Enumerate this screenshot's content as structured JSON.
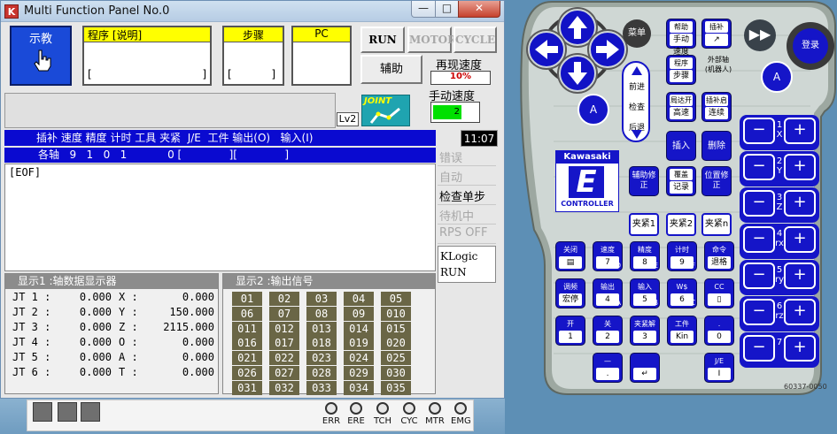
{
  "window": {
    "title": "Multi Function Panel No.0",
    "icon_letter": "K",
    "min": "—",
    "max": "□",
    "close": "✕"
  },
  "mode": {
    "label": "示教",
    "icon": "hand-pointer-icon"
  },
  "fields": {
    "program": {
      "label": "程序 [说明]",
      "value_open": "[",
      "value_close": "]"
    },
    "step": {
      "label": "步骤",
      "value_open": "[",
      "value_close": "]"
    },
    "pc": {
      "label": "PC"
    }
  },
  "buttons": {
    "run": "RUN",
    "motor": "MOTOR",
    "cycle": "CYCLE",
    "aux": "辅助"
  },
  "speed": {
    "replay_label": "再现速度",
    "replay_value": "10%",
    "manual_label": "手动速度",
    "manual_value": "2"
  },
  "level": "Lv2",
  "joint_label": "JOINT",
  "status_bar": {
    "header": "插补 速度 精度 计时 工具 夹紧  J/E  工件 输出(O)   输入(I)",
    "values": "各轴   9   1   0   1            0 [              ][              ]",
    "clock": "11:07"
  },
  "program_text": "[EOF]",
  "side_status": [
    "错误",
    "自动",
    "检查单步",
    "待机中",
    "RPS OFF"
  ],
  "side_status_enabled": [
    false,
    false,
    true,
    false,
    false
  ],
  "klogic": [
    "KLogic",
    "RUN"
  ],
  "display1": {
    "title": "显示1 :轴数据显示器",
    "rows": [
      {
        "jt": "JT 1 :",
        "jv": "0.000",
        "ax": "X :",
        "av": "0.000"
      },
      {
        "jt": "JT 2 :",
        "jv": "0.000",
        "ax": "Y :",
        "av": "150.000"
      },
      {
        "jt": "JT 3 :",
        "jv": "0.000",
        "ax": "Z :",
        "av": "2115.000"
      },
      {
        "jt": "JT 4 :",
        "jv": "0.000",
        "ax": "O :",
        "av": "0.000"
      },
      {
        "jt": "JT 5 :",
        "jv": "0.000",
        "ax": "A :",
        "av": "0.000"
      },
      {
        "jt": "JT 6 :",
        "jv": "0.000",
        "ax": "T :",
        "av": "0.000"
      }
    ]
  },
  "display2": {
    "title": "显示2 :输出信号",
    "signals": [
      "01",
      "02",
      "03",
      "04",
      "05",
      "06",
      "07",
      "08",
      "09",
      "010",
      "011",
      "012",
      "013",
      "014",
      "015",
      "016",
      "017",
      "018",
      "019",
      "020",
      "021",
      "022",
      "023",
      "024",
      "025",
      "026",
      "027",
      "028",
      "029",
      "030",
      "031",
      "032",
      "033",
      "034",
      "035"
    ]
  },
  "taskbar": {
    "lamps": [
      "ERR",
      "ERE",
      "TCH",
      "CYC",
      "MTR",
      "EMG"
    ]
  },
  "pendant": {
    "menu": "菜单",
    "login": "登录",
    "a": "A",
    "forward": "前进",
    "check": "检查",
    "back": "后退",
    "top_keys": [
      {
        "cap": "帮助",
        "sub": "手动速度"
      },
      {
        "cap": "插补",
        "sub": "↗"
      },
      {
        "cap": "程序",
        "sub": "步骤"
      },
      {
        "cap": "外部轴",
        "sub": "(机器人)"
      },
      {
        "cap": "局达开",
        "sub": "高速"
      },
      {
        "cap": "插补启动",
        "sub": "连续"
      }
    ],
    "insert": "插入",
    "delete": "删除",
    "aux_mod": "辅助修正",
    "cover": "覆盖",
    "record": "记录",
    "pos_mod": "位置修正",
    "clamp1": "夹紧1",
    "clamp2": "夹紧2",
    "clampn": "夹紧n",
    "brand": "Kawasaki",
    "controller": "CONTROLLER",
    "model_code": "60337-0050",
    "num_keys": [
      {
        "cap": "关闭",
        "sub": "▤",
        "num": ""
      },
      {
        "cap": "速度",
        "sub": "7",
        "num": "D"
      },
      {
        "cap": "精度",
        "sub": "8",
        "num": "E"
      },
      {
        "cap": "计时",
        "sub": "9",
        "num": "F"
      },
      {
        "cap": "命令",
        "sub": "退格",
        "num": ""
      },
      {
        "cap": "调频",
        "sub": "宏停",
        "num": ""
      },
      {
        "cap": "输出",
        "sub": "4",
        "num": "A"
      },
      {
        "cap": "输入",
        "sub": "5",
        "num": "B"
      },
      {
        "cap": "W$",
        "sub": "6",
        "num": "C"
      },
      {
        "cap": "CC",
        "sub": "▯",
        "num": ""
      },
      {
        "cap": "开",
        "sub": "1",
        "num": ""
      },
      {
        "cap": "关",
        "sub": "2",
        "num": ""
      },
      {
        "cap": "夹紧解除",
        "sub": "3",
        "num": ""
      },
      {
        "cap": "工件",
        "sub": "Kin",
        "num": ""
      },
      {
        "cap": ".",
        "sub": "0",
        "num": ""
      },
      {
        "cap": "—",
        "sub": ".",
        "num": ""
      },
      {
        "cap": "",
        "sub": "↵",
        "num": ""
      },
      {
        "cap": "J/E",
        "sub": "I",
        "num": ""
      }
    ],
    "axes": [
      {
        "n": "1",
        "l": "X"
      },
      {
        "n": "2",
        "l": "Y"
      },
      {
        "n": "3",
        "l": "Z"
      },
      {
        "n": "4",
        "l": "rx"
      },
      {
        "n": "5",
        "l": "ry"
      },
      {
        "n": "6",
        "l": "rz"
      },
      {
        "n": "7",
        "l": ""
      }
    ],
    "minus": "−",
    "plus": "+"
  },
  "colors": {
    "accent_blue": "#1515c8",
    "field_yellow": "#ffff00",
    "status_bar": "#0a0ad0",
    "signal": "#6a6646"
  }
}
